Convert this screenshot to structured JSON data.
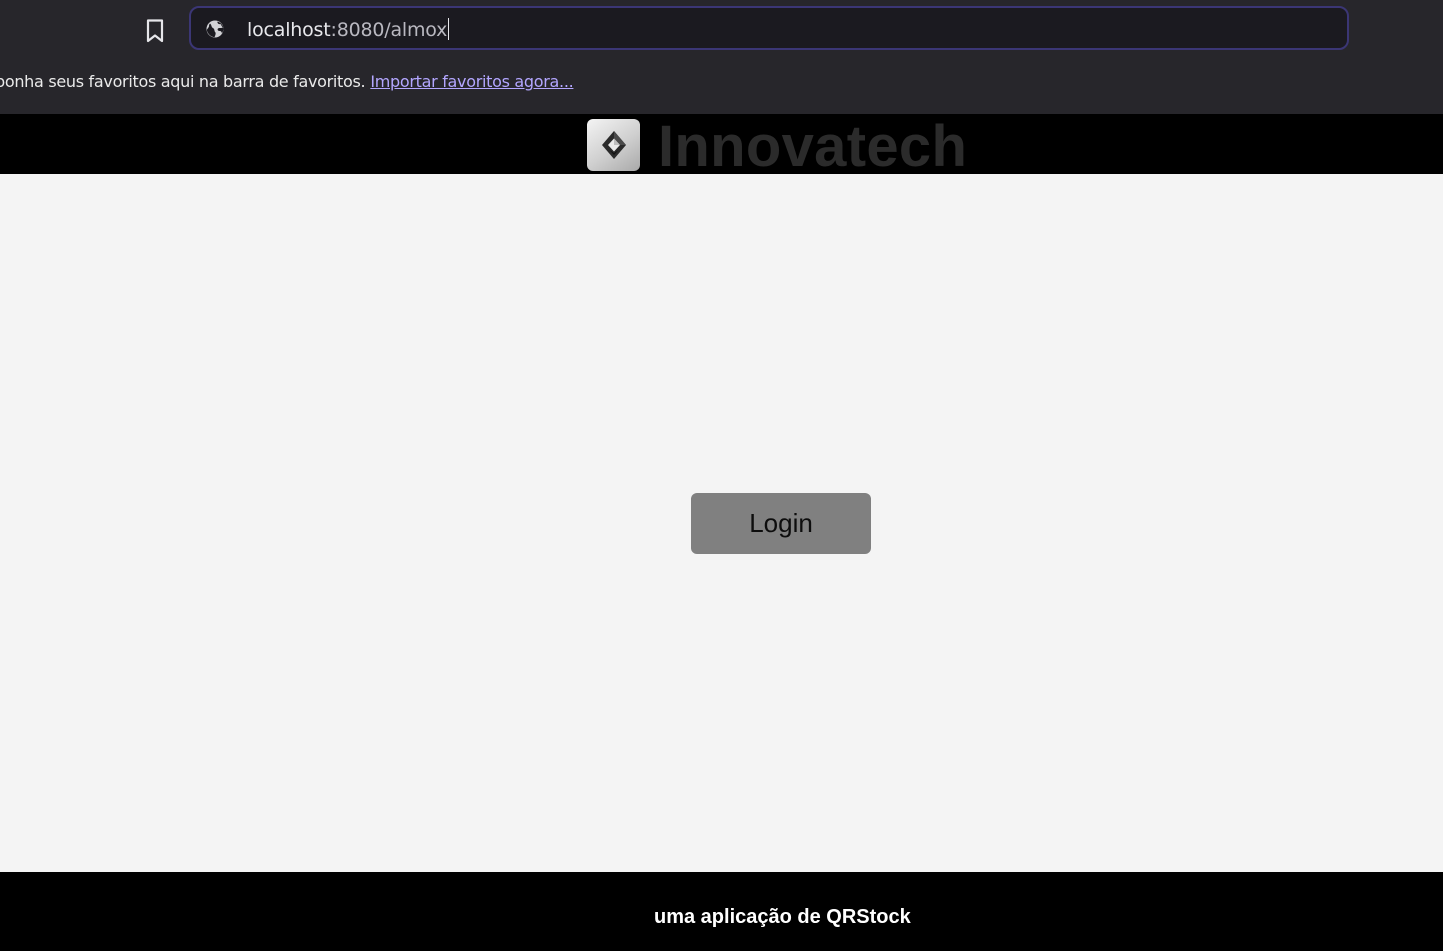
{
  "browser": {
    "url_host": "localhost",
    "url_path": ":8080/almox",
    "bookmarks_bar_message": "ponha seus favoritos aqui na barra de favoritos.",
    "bookmarks_bar_link": "Importar favoritos agora..."
  },
  "app": {
    "brand_name": "Innovatech",
    "login_label": "Login",
    "footer_text": "uma aplicação de QRStock"
  },
  "icons": {
    "bookmark": "bookmark-icon",
    "site_info": "globe-icon",
    "logo": "innovatech-logo"
  },
  "colors": {
    "chrome_bg": "#27262b",
    "header_bg": "#000000",
    "page_bg": "#f4f4f4",
    "button_bg": "#808080",
    "link": "#b3a6ff"
  }
}
